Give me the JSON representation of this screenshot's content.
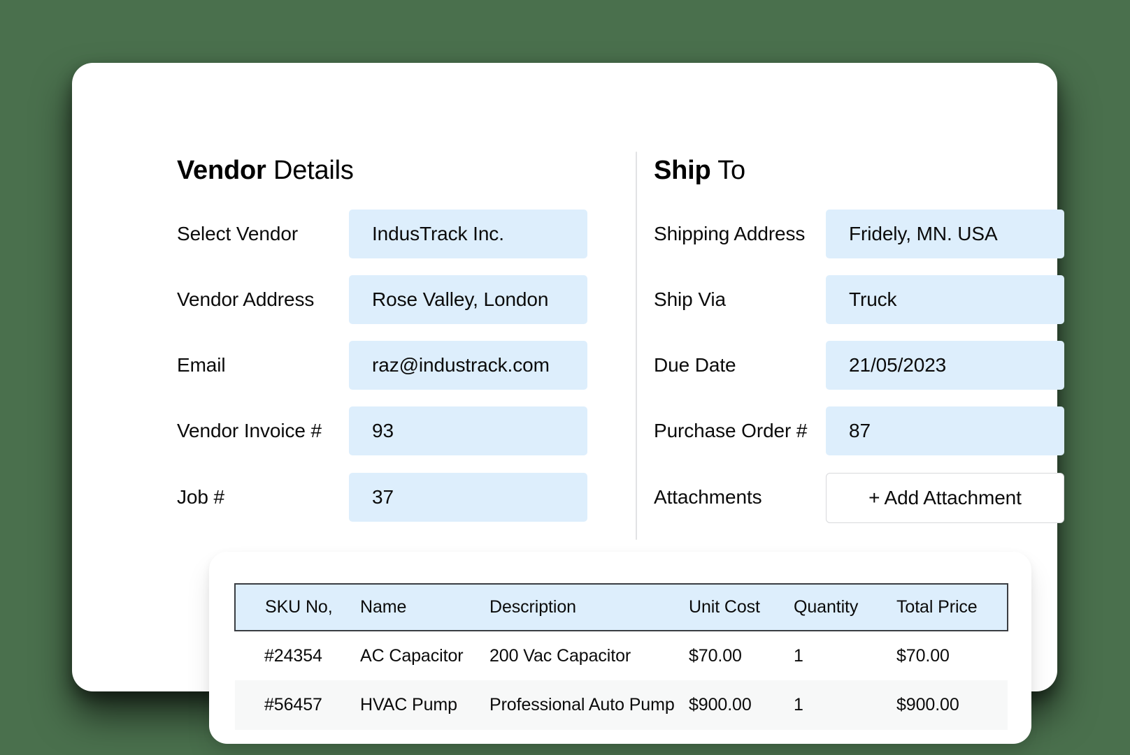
{
  "theme": {
    "page_background": "#4a704d",
    "card_background": "#ffffff",
    "field_fill": "#ddeefc",
    "table_header_fill": "#ddeefc",
    "table_border": "#3a3d42",
    "row_alt_fill": "#f7f8f8",
    "text_color": "#0b0b0b",
    "divider": "#e2e3e5"
  },
  "vendor_section": {
    "title_strong": "Vendor",
    "title_light": " Details",
    "fields": [
      {
        "label": "Select Vendor",
        "value": "IndusTrack Inc."
      },
      {
        "label": "Vendor Address",
        "value": "Rose Valley, London"
      },
      {
        "label": "Email",
        "value": "raz@industrack.com"
      },
      {
        "label": "Vendor Invoice #",
        "value": "93"
      },
      {
        "label": "Job #",
        "value": "37"
      }
    ]
  },
  "shipto_section": {
    "title_strong": "Ship",
    "title_light": " To",
    "fields": [
      {
        "label": "Shipping Address",
        "value": "Fridely, MN. USA"
      },
      {
        "label": "Ship Via",
        "value": "Truck"
      },
      {
        "label": "Due Date",
        "value": "21/05/2023"
      },
      {
        "label": "Purchase Order #",
        "value": "87"
      }
    ],
    "attachments": {
      "label": "Attachments",
      "button_label": "+ Add Attachment"
    }
  },
  "items_table": {
    "columns": [
      "SKU No,",
      "Name",
      "Description",
      "Unit Cost",
      "Quantity",
      "Total Price"
    ],
    "rows": [
      {
        "sku": "#24354",
        "name": "AC Capacitor",
        "description": "200 Vac Capacitor",
        "unit_cost": "$70.00",
        "quantity": "1",
        "total_price": "$70.00"
      },
      {
        "sku": "#56457",
        "name": "HVAC Pump",
        "description": "Professional Auto Pump",
        "unit_cost": "$900.00",
        "quantity": "1",
        "total_price": "$900.00"
      }
    ]
  }
}
